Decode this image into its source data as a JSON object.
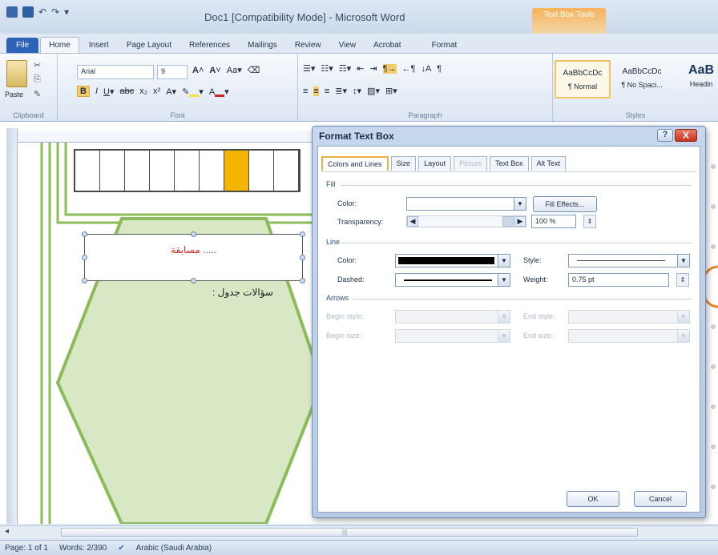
{
  "window": {
    "title": "Doc1 [Compatibility Mode] - Microsoft Word",
    "context_tab_group": "Text Box Tools"
  },
  "ribbon_tabs": [
    "File",
    "Home",
    "Insert",
    "Page Layout",
    "References",
    "Mailings",
    "Review",
    "View",
    "Acrobat",
    "Format"
  ],
  "ribbon": {
    "clipboard": {
      "label": "Clipboard",
      "paste": "Paste"
    },
    "font": {
      "label": "Font",
      "font_name": "Arial",
      "font_size": "9"
    },
    "paragraph": {
      "label": "Paragraph"
    },
    "styles": {
      "label": "Styles",
      "items": [
        {
          "sample": "AaBbCcDc",
          "name": "¶ Normal"
        },
        {
          "sample": "AaBbCcDc",
          "name": "¶ No Spaci..."
        },
        {
          "sample": "AaB",
          "name": "Headin"
        }
      ]
    }
  },
  "document": {
    "textbox_text": "مسابقة .....",
    "questions_label": "سؤالات جدول :"
  },
  "dialog": {
    "title": "Format Text Box",
    "help": "?",
    "close": "X",
    "tabs": [
      {
        "label": "Colors and Lines",
        "state": "active"
      },
      {
        "label": "Size",
        "state": "normal"
      },
      {
        "label": "Layout",
        "state": "normal"
      },
      {
        "label": "Picture",
        "state": "disabled"
      },
      {
        "label": "Text Box",
        "state": "normal"
      },
      {
        "label": "Alt Text",
        "state": "normal"
      }
    ],
    "fill": {
      "section": "Fill",
      "color_label": "Color:",
      "fill_effects": "Fill Effects...",
      "transparency_label": "Transparency:",
      "transparency_value": "100 %"
    },
    "line": {
      "section": "Line",
      "color_label": "Color:",
      "style_label": "Style:",
      "dashed_label": "Dashed:",
      "weight_label": "Weight:",
      "weight_value": "0.75 pt",
      "line_color": "#000000"
    },
    "arrows": {
      "section": "Arrows",
      "begin_style": "Begin style:",
      "end_style": "End style:",
      "begin_size": "Begin size:",
      "end_size": "End size:"
    },
    "ok": "OK",
    "cancel": "Cancel"
  },
  "status": {
    "page": "Page: 1 of 1",
    "words": "Words: 2/390",
    "language": "Arabic (Saudi Arabia)"
  },
  "colors": {
    "file_tab": "#2d63b6",
    "highlight_cell": "#f5b400",
    "hexagon_fill": "#d9e8c4",
    "hexagon_stroke": "#8cbb5a"
  }
}
